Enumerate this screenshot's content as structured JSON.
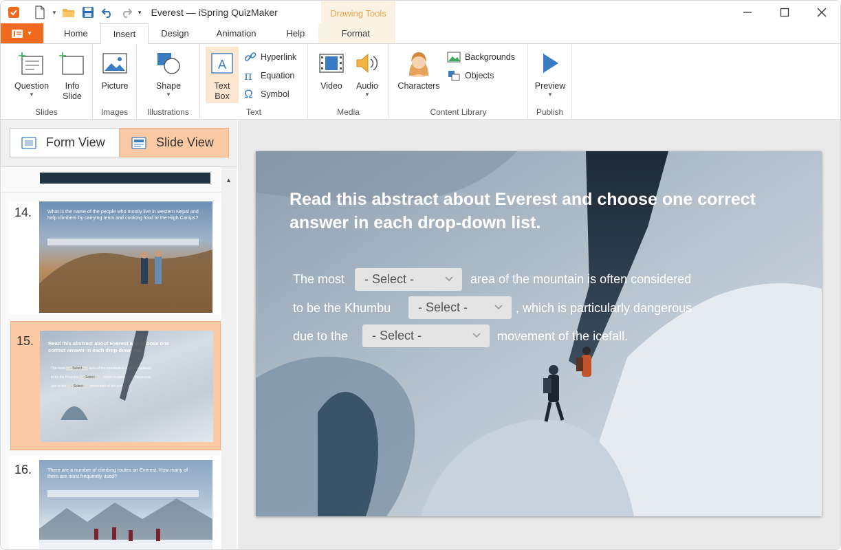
{
  "window": {
    "title": "Everest — iSpring QuizMaker",
    "contextual_tab_group": "Drawing Tools"
  },
  "tabs": [
    "Home",
    "Insert",
    "Design",
    "Animation",
    "Help",
    "Format"
  ],
  "active_tab": "Insert",
  "ribbon": {
    "slides": {
      "label": "Slides",
      "question": "Question",
      "info_slide_line1": "Info",
      "info_slide_line2": "Slide"
    },
    "images": {
      "label": "Images",
      "picture": "Picture"
    },
    "illustrations": {
      "label": "Illustrations",
      "shape": "Shape"
    },
    "text": {
      "label": "Text",
      "textbox_line1": "Text",
      "textbox_line2": "Box",
      "hyperlink": "Hyperlink",
      "equation": "Equation",
      "symbol": "Symbol"
    },
    "media": {
      "label": "Media",
      "video": "Video",
      "audio": "Audio"
    },
    "content_library": {
      "label": "Content Library",
      "characters": "Characters",
      "backgrounds": "Backgrounds",
      "objects": "Objects"
    },
    "publish": {
      "label": "Publish",
      "preview": "Preview"
    }
  },
  "view_switch": {
    "form_view": "Form View",
    "slide_view": "Slide View",
    "selected": "Slide View"
  },
  "thumbnails": [
    {
      "number": "14.",
      "text": "What is the name of the people who mostly live in western Nepal and help climbers by carrying tents and cooking food to the High Camps?"
    },
    {
      "number": "15.",
      "title": "Read this abstract about Everest and choose one correct answer in each drop-down list.",
      "line1a": "The most",
      "line1b": "area of the mountain is often considered",
      "line2a": "to be the Khumbu",
      "line2b": ", which is particularly dangerous",
      "line3a": "due to the",
      "line3b": "movement of the icefall.",
      "select": "- Select -"
    },
    {
      "number": "16.",
      "text": "There are a number of climbing routes on Everest. How many of them are most frequently used?"
    }
  ],
  "selected_thumbnail": "15.",
  "slide": {
    "title": "Read this abstract about Everest and choose one correct answer in each drop-down list.",
    "line1_before": "The most",
    "line1_after": "area of the mountain is often considered",
    "line2_before": "to be the Khumbu",
    "line2_after": ", which is particularly dangerous",
    "line3_before": "due to the",
    "line3_after": "movement of the icefall.",
    "dropdown_placeholder": "- Select -"
  },
  "colors": {
    "accent": "#f06a1d",
    "selection": "#fbc9a4",
    "drawing_tools": "#e8a34e"
  }
}
